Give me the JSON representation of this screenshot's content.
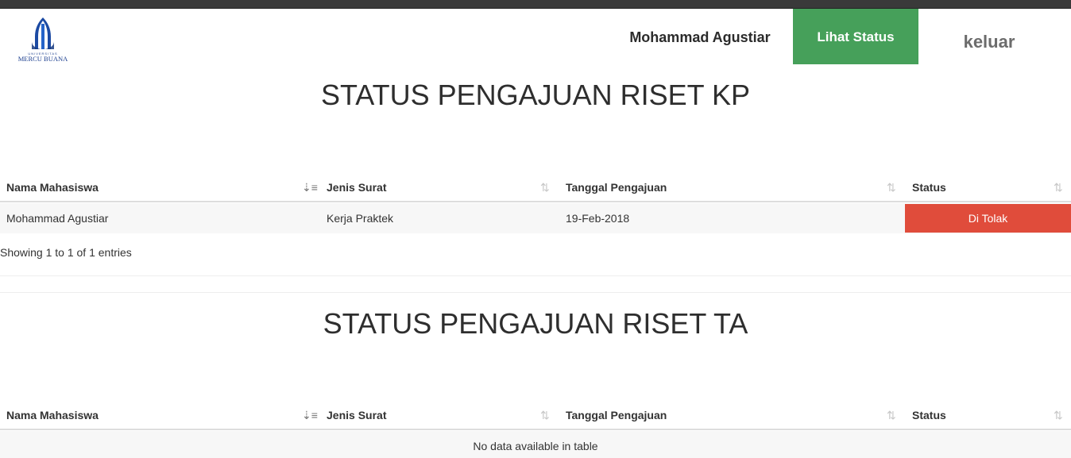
{
  "brand": {
    "logo_text": "MERCU BUANA",
    "logo_subtext": "UNIVERSITAS",
    "colors": {
      "logo_blue": "#1c3f8f"
    }
  },
  "nav": {
    "user_name": "Mohammad Agustiar",
    "status_label": "Lihat Status",
    "logout_label": "keluar",
    "colors": {
      "status_bg": "#46a05a"
    }
  },
  "kp_section": {
    "title": "STATUS PENGAJUAN RISET KP",
    "columns": [
      "Nama Mahasiswa",
      "Jenis Surat",
      "Tanggal Pengajuan",
      "Status"
    ],
    "rows": [
      {
        "nama": "Mohammad Agustiar",
        "jenis": "Kerja Praktek",
        "tanggal": "19-Feb-2018",
        "status": "Di Tolak"
      }
    ],
    "info": "Showing 1 to 1 of 1 entries",
    "colors": {
      "status_rejected": "#e04c3b"
    }
  },
  "ta_section": {
    "title": "STATUS PENGAJUAN RISET TA",
    "columns": [
      "Nama Mahasiswa",
      "Jenis Surat",
      "Tanggal Pengajuan",
      "Status"
    ],
    "empty_text": "No data available in table"
  },
  "icons": {
    "sort_active": "sort-ascending-icon",
    "sort_inactive": "sort-both-icon"
  }
}
